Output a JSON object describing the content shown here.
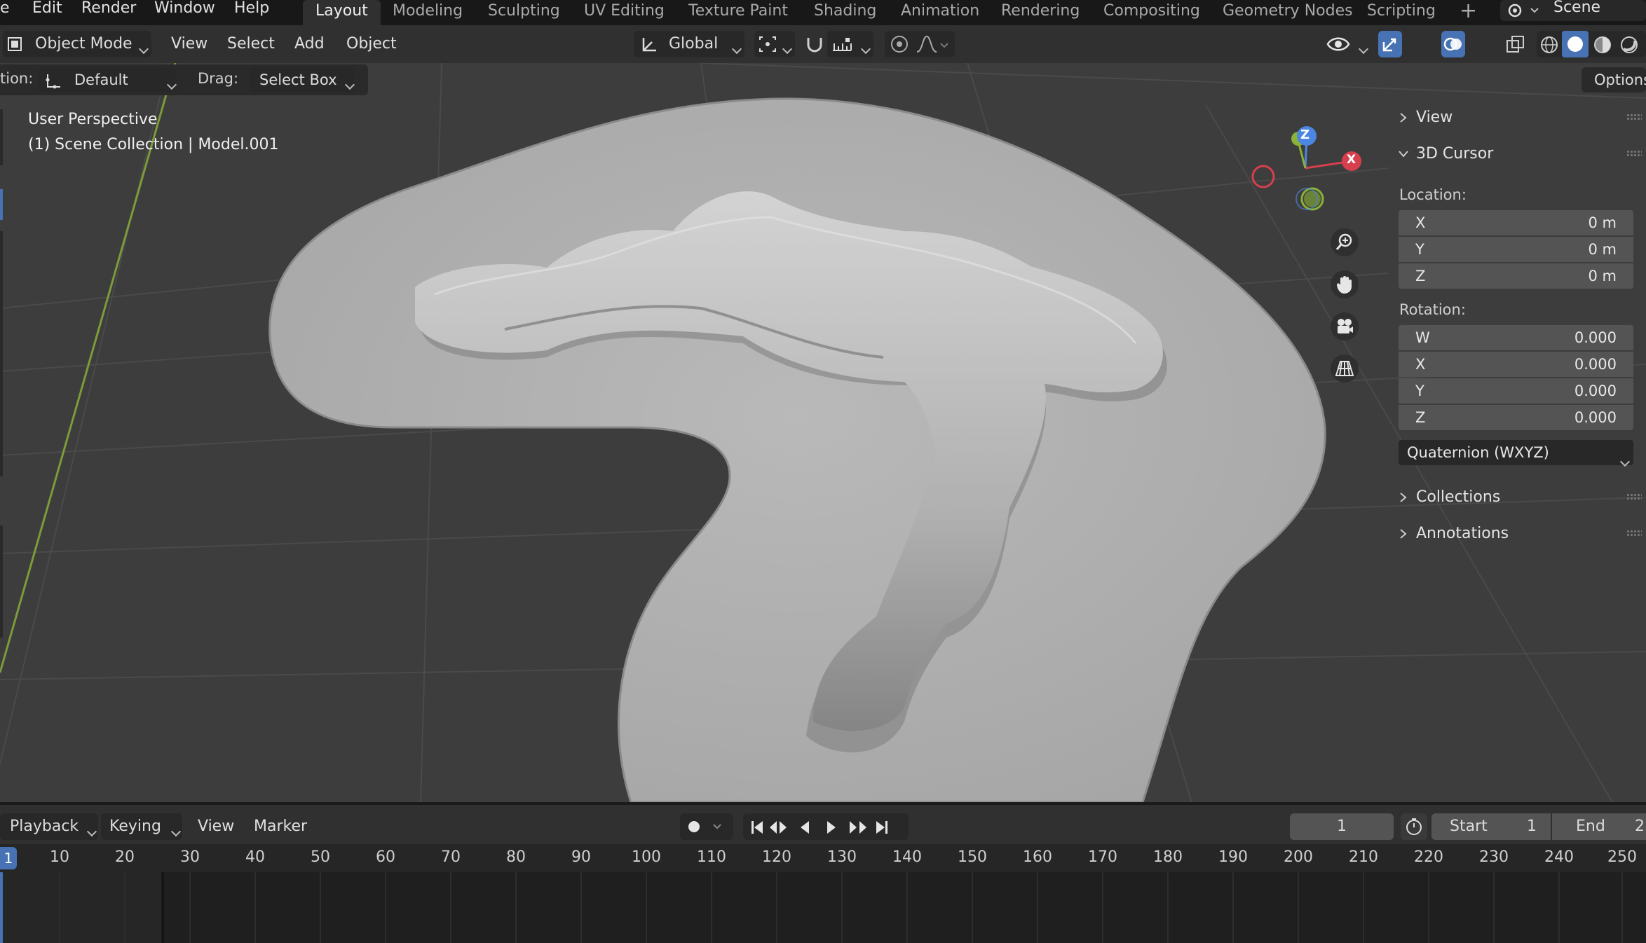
{
  "menu": [
    "e",
    "Edit",
    "Render",
    "Window",
    "Help"
  ],
  "workspaces": [
    "Layout",
    "Modeling",
    "Sculpting",
    "UV Editing",
    "Texture Paint",
    "Shading",
    "Animation",
    "Rendering",
    "Compositing",
    "Geometry Nodes",
    "Scripting"
  ],
  "active_workspace": "Layout",
  "scene_name": "Scene",
  "header": {
    "mode": "Object Mode",
    "menus": [
      "View",
      "Select",
      "Add",
      "Object"
    ],
    "transform_orientation": "Global"
  },
  "tool_settings": {
    "orientation_label": "tion:",
    "orientation_value": "Default",
    "drag_label": "Drag:",
    "drag_value": "Select Box",
    "options_label": "Options"
  },
  "viewport": {
    "view_name": "User Perspective",
    "collection_info": "(1) Scene Collection | Model.001",
    "gizmo": {
      "x": "X",
      "z": "Z"
    }
  },
  "sidebar": {
    "view_label": "View",
    "cursor_label": "3D Cursor",
    "location_label": "Location:",
    "location": [
      {
        "k": "X",
        "v": "0 m"
      },
      {
        "k": "Y",
        "v": "0 m"
      },
      {
        "k": "Z",
        "v": "0 m"
      }
    ],
    "rotation_label": "Rotation:",
    "rotation": [
      {
        "k": "W",
        "v": "0.000"
      },
      {
        "k": "X",
        "v": "0.000"
      },
      {
        "k": "Y",
        "v": "0.000"
      },
      {
        "k": "Z",
        "v": "0.000"
      }
    ],
    "rotation_mode": "Quaternion (WXYZ)",
    "collections_label": "Collections",
    "annotations_label": "Annotations"
  },
  "timeline": {
    "menus": [
      "Playback",
      "Keying",
      "View",
      "Marker"
    ],
    "current_frame": "1",
    "start_label": "Start",
    "start_value": "1",
    "end_label": "End",
    "end_value": "2",
    "ruler": [
      "10",
      "20",
      "30",
      "40",
      "50",
      "60",
      "70",
      "80",
      "90",
      "100",
      "110",
      "120",
      "130",
      "140",
      "150",
      "160",
      "170",
      "180",
      "190",
      "200",
      "210",
      "220",
      "230",
      "240",
      "250"
    ],
    "ruler_current": "1"
  },
  "colors": {
    "accent": "#4772b3",
    "x_axis": "#d6404e",
    "y_axis": "#8bb236",
    "z_axis": "#4b86e0"
  }
}
